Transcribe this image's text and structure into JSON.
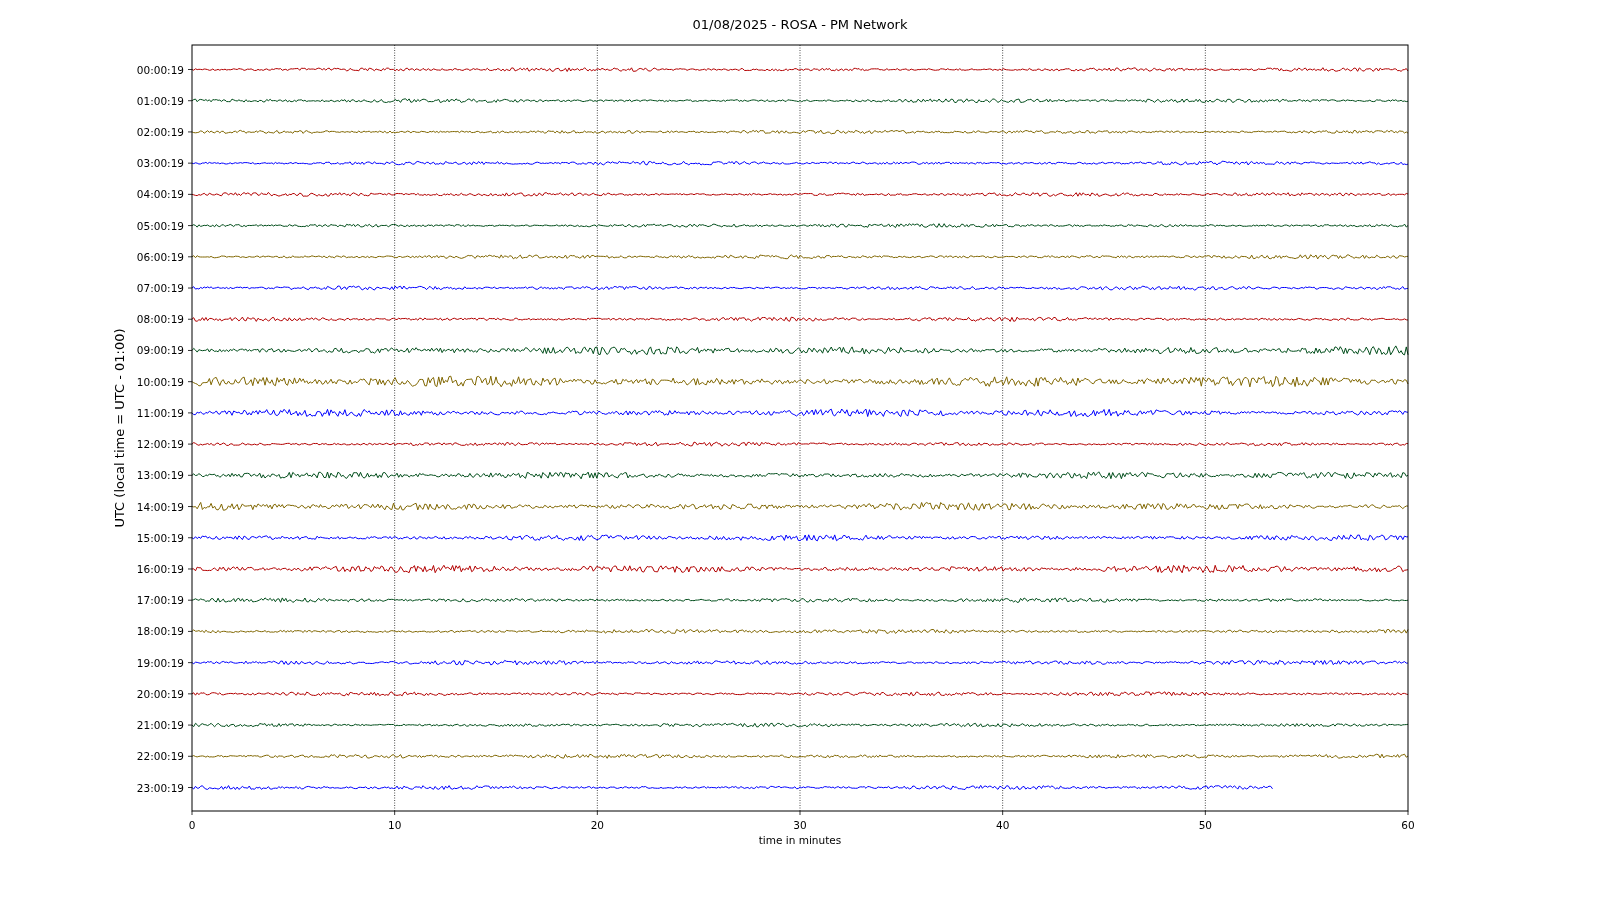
{
  "title": "01/08/2025 - ROSA - PM Network",
  "ylabel": "UTC (local time = UTC - 01:00)",
  "xlabel": "time in minutes",
  "xticks": [
    "0",
    "10",
    "20",
    "30",
    "40",
    "50",
    "60"
  ],
  "rows": [
    {
      "label": "00:00:19",
      "color": "#b30000",
      "level": 1
    },
    {
      "label": "01:00:19",
      "color": "#004d1a",
      "level": 1
    },
    {
      "label": "02:00:19",
      "color": "#806600",
      "level": 1
    },
    {
      "label": "03:00:19",
      "color": "#0000ff",
      "level": 1
    },
    {
      "label": "04:00:19",
      "color": "#b30000",
      "level": 1
    },
    {
      "label": "05:00:19",
      "color": "#004d1a",
      "level": 1
    },
    {
      "label": "06:00:19",
      "color": "#806600",
      "level": 1
    },
    {
      "label": "07:00:19",
      "color": "#0000ff",
      "level": 1
    },
    {
      "label": "08:00:19",
      "color": "#b30000",
      "level": 1
    },
    {
      "label": "09:00:19",
      "color": "#004d1a",
      "level": 1
    },
    {
      "label": "10:00:19",
      "color": "#806600",
      "level": 1
    },
    {
      "label": "11:00:19",
      "color": "#0000ff",
      "level": 1
    },
    {
      "label": "12:00:19",
      "color": "#b30000",
      "level": 1
    },
    {
      "label": "13:00:19",
      "color": "#004d1a",
      "level": 1
    },
    {
      "label": "14:00:19",
      "color": "#806600",
      "level": 1
    },
    {
      "label": "15:00:19",
      "color": "#0000ff",
      "level": 1
    },
    {
      "label": "16:00:19",
      "color": "#b30000",
      "level": 1
    },
    {
      "label": "17:00:19",
      "color": "#004d1a",
      "level": 1
    },
    {
      "label": "18:00:19",
      "color": "#806600",
      "level": 1
    },
    {
      "label": "19:00:19",
      "color": "#0000ff",
      "level": 1
    },
    {
      "label": "20:00:19",
      "color": "#b30000",
      "level": 1
    },
    {
      "label": "21:00:19",
      "color": "#004d1a",
      "level": 1
    },
    {
      "label": "22:00:19",
      "color": "#806600",
      "level": 1
    },
    {
      "label": "23:00:19",
      "color": "#0000ff",
      "level": 0.888
    }
  ]
}
